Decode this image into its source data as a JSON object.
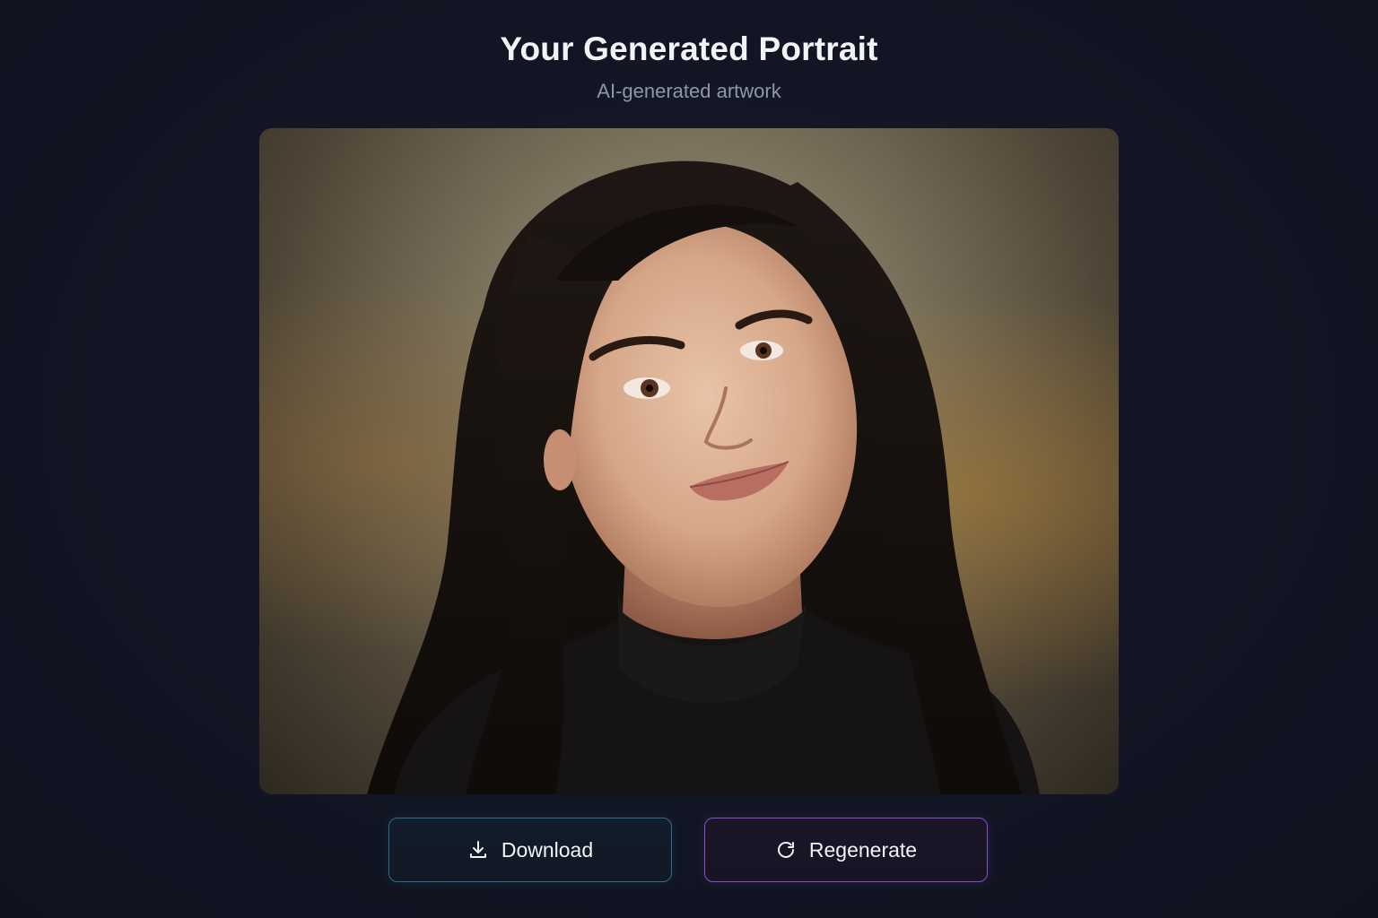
{
  "header": {
    "title": "Your Generated Portrait",
    "subtitle": "AI-generated artwork"
  },
  "portrait": {
    "description_icon": "portrait-image"
  },
  "actions": {
    "download_label": "Download",
    "download_icon": "download-icon",
    "regenerate_label": "Regenerate",
    "regenerate_icon": "refresh-icon"
  },
  "colors": {
    "background": "#121624",
    "download_border": "#2b6f8a",
    "regenerate_border": "#8b4fc8",
    "title_text": "#f3f4f7",
    "subtitle_text": "#9096a6"
  }
}
